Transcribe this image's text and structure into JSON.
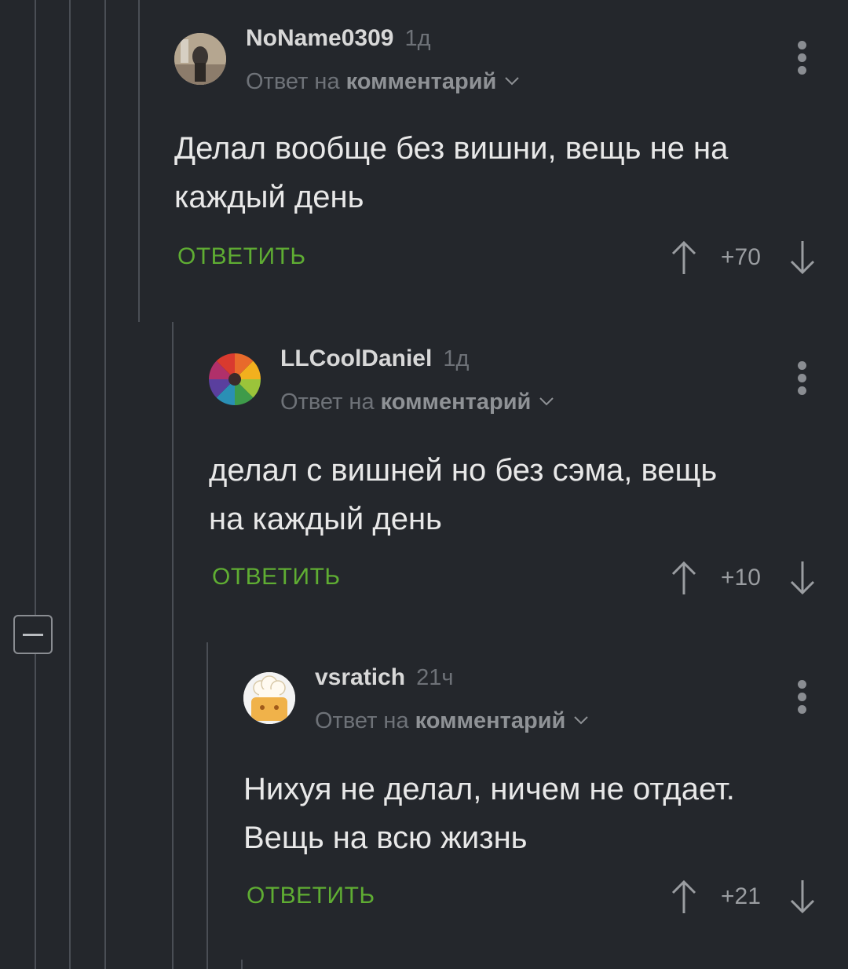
{
  "comments": [
    {
      "username": "NoName0309",
      "age": "1д",
      "reply_prefix": "Ответ на",
      "reply_link": "комментарий",
      "text_line1": "Делал вообще без вишни, вещь не на",
      "text_line2": "каждый день",
      "reply_label": "ОТВЕТИТЬ",
      "score": "+70"
    },
    {
      "username": "LLCoolDaniel",
      "age": "1д",
      "reply_prefix": "Ответ на",
      "reply_link": "комментарий",
      "text_line1": "делал с вишней но без сэма, вещь",
      "text_line2": "на каждый день",
      "reply_label": "ОТВЕТИТЬ",
      "score": "+10"
    },
    {
      "username": "vsratich",
      "age": "21ч",
      "reply_prefix": "Ответ на",
      "reply_link": "комментарий",
      "text_line1": "Нихуя не делал, ничем не отдает.",
      "text_line2": "Вещь на всю жизнь",
      "reply_label": "ОТВЕТИТЬ",
      "score": "+21"
    }
  ],
  "colors": {
    "background": "#24272c",
    "accent_green": "#5fad33",
    "thread_line": "#4a4e55",
    "muted_text": "#6e7278"
  },
  "icons": {
    "upvote": "arrow-up-icon",
    "downvote": "arrow-down-icon",
    "more": "more-vertical-icon",
    "collapse": "minus-square-icon",
    "chevron": "chevron-down-icon"
  }
}
